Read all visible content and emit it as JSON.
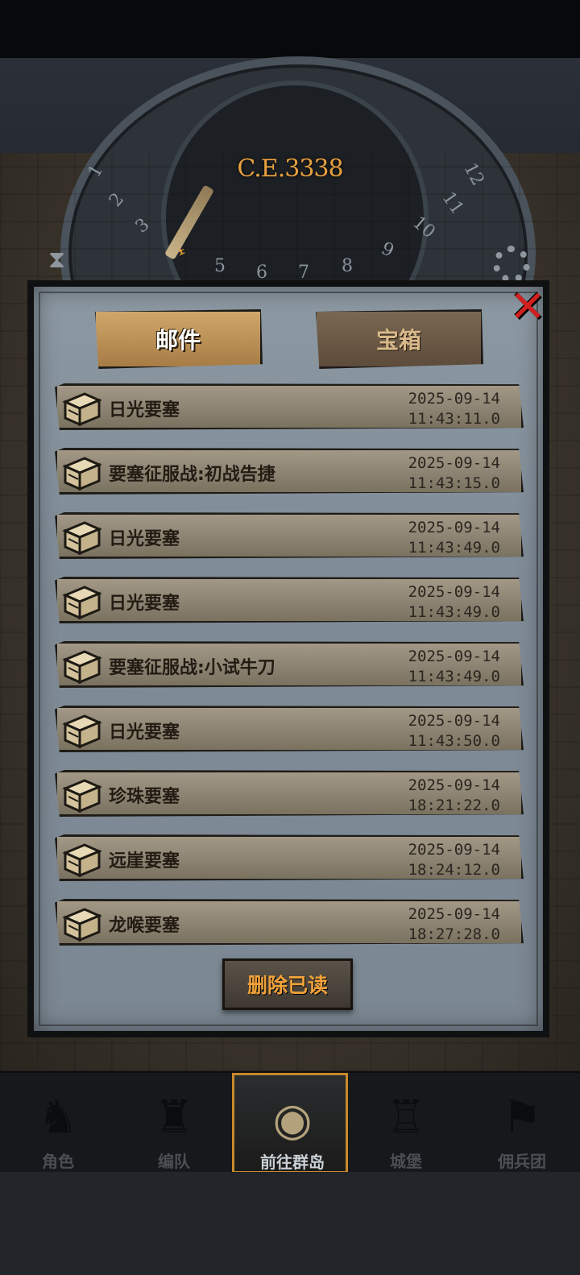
{
  "era": "C.E.3338",
  "dial_numbers": [
    "1",
    "2",
    "3",
    "4",
    "5",
    "6",
    "7",
    "8",
    "9",
    "10",
    "11",
    "12"
  ],
  "dial_highlight": "4",
  "tabs": {
    "mail": "邮件",
    "chest": "宝箱"
  },
  "close_icon": "close-icon",
  "mails": [
    {
      "title": "日光要塞",
      "date": "2025-09-14",
      "time": "11:43:11.0"
    },
    {
      "title": "要塞征服战:初战告捷",
      "date": "2025-09-14",
      "time": "11:43:15.0"
    },
    {
      "title": "日光要塞",
      "date": "2025-09-14",
      "time": "11:43:49.0"
    },
    {
      "title": "日光要塞",
      "date": "2025-09-14",
      "time": "11:43:49.0"
    },
    {
      "title": "要塞征服战:小试牛刀",
      "date": "2025-09-14",
      "time": "11:43:49.0"
    },
    {
      "title": "日光要塞",
      "date": "2025-09-14",
      "time": "11:43:50.0"
    },
    {
      "title": "珍珠要塞",
      "date": "2025-09-14",
      "time": "18:21:22.0"
    },
    {
      "title": "远崖要塞",
      "date": "2025-09-14",
      "time": "18:24:12.0"
    },
    {
      "title": "龙喉要塞",
      "date": "2025-09-14",
      "time": "18:27:28.0"
    }
  ],
  "delete_read": "删除已读",
  "nav": [
    {
      "label": "角色",
      "icon": "knight-icon"
    },
    {
      "label": "编队",
      "icon": "formation-icon"
    },
    {
      "label": "前往群岛",
      "icon": "globe-icon"
    },
    {
      "label": "城堡",
      "icon": "castle-icon"
    },
    {
      "label": "佣兵团",
      "icon": "mercenary-icon"
    }
  ],
  "colors": {
    "accent": "#e79a35",
    "close": "#d21f1f",
    "active_border": "#c88a2a"
  }
}
